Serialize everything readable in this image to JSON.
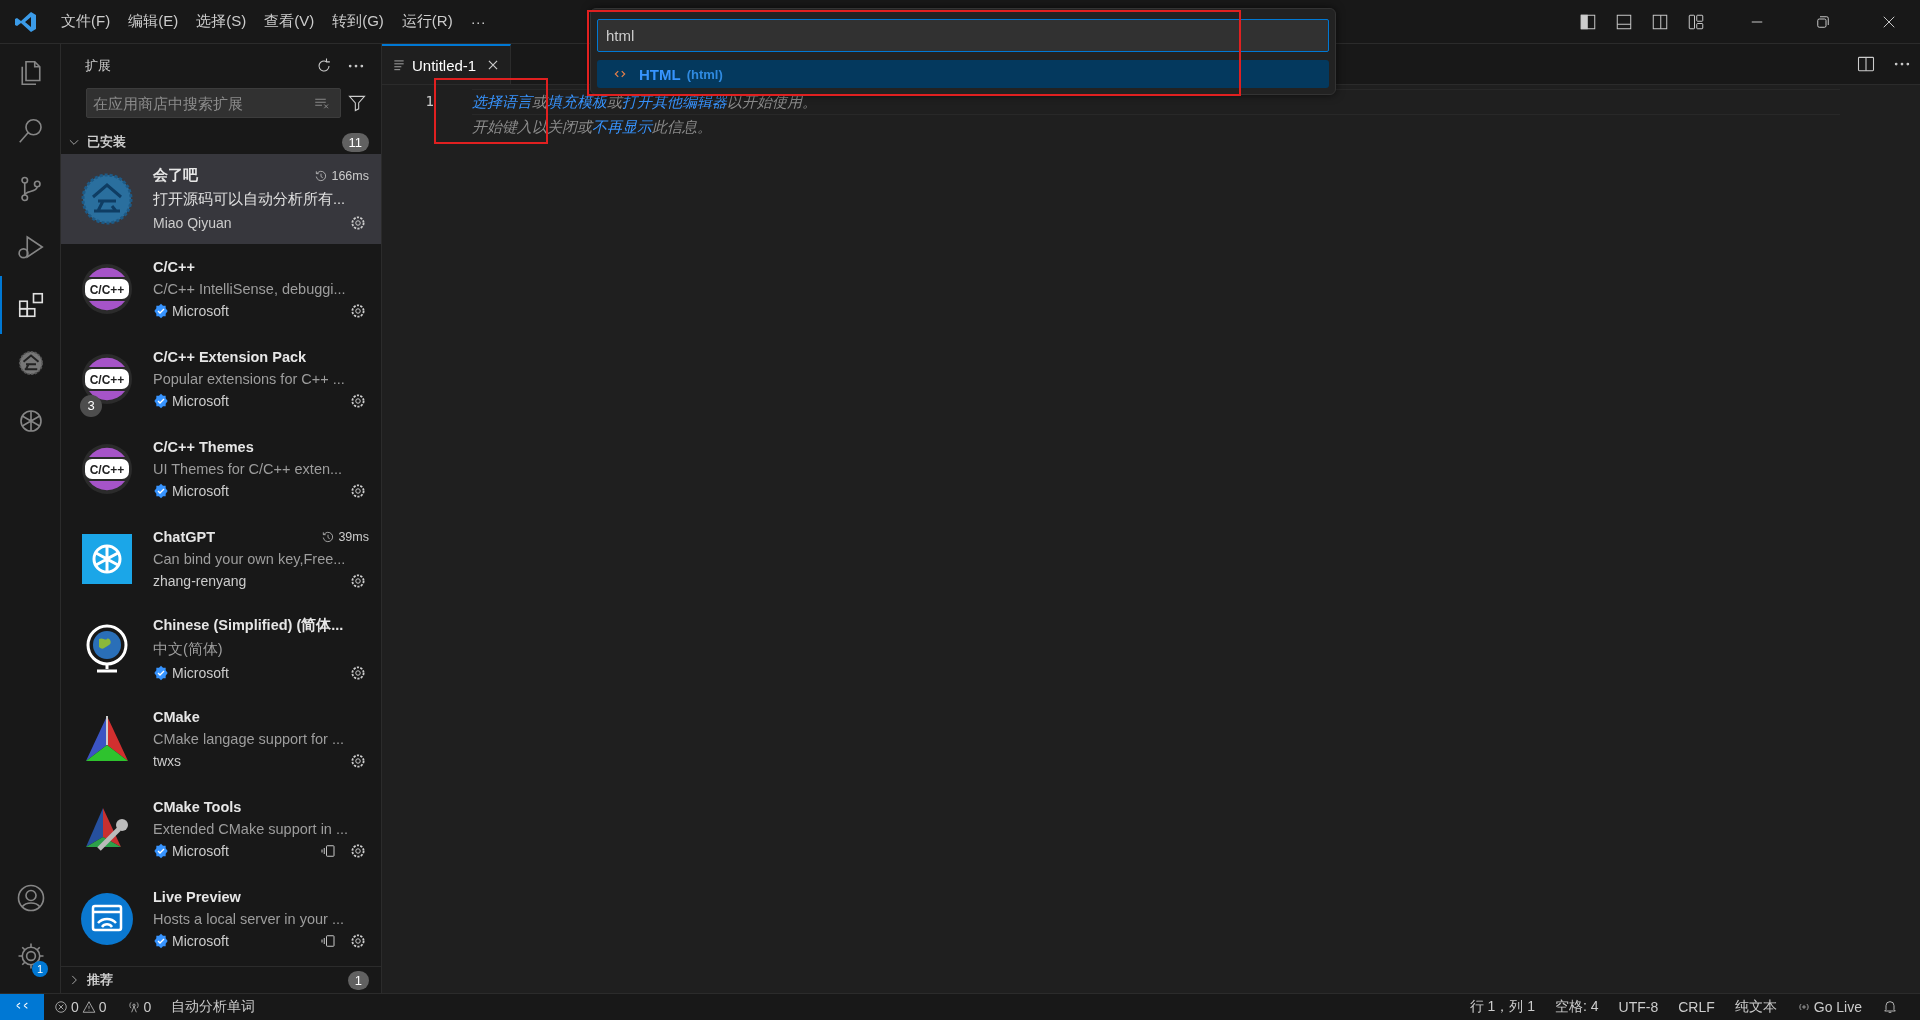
{
  "title_bar": {
    "menus": [
      "文件(F)",
      "编辑(E)",
      "选择(S)",
      "查看(V)",
      "转到(G)",
      "运行(R)"
    ],
    "more": "···"
  },
  "command_palette": {
    "value": "html",
    "results": [
      {
        "label": "HTML",
        "detail": "(html)",
        "selected": true
      }
    ]
  },
  "activity_bar": {
    "items": [
      {
        "selected": false
      },
      {
        "selected": false
      },
      {
        "selected": false
      },
      {
        "selected": false
      },
      {
        "selected": true
      },
      {
        "selected": false
      },
      {
        "selected": false
      }
    ],
    "settings_badge": "1"
  },
  "sidebar": {
    "title": "扩展",
    "search": {
      "placeholder": "在应用商店中搜索扩展"
    },
    "installed": {
      "label": "已安装",
      "count": "11",
      "expanded": true,
      "items": [
        {
          "name": "会了吧",
          "description": "打开源码可以自动分析所有...",
          "publisher": "Miao Qiyuan",
          "verified": false,
          "time": "166ms",
          "selected": true,
          "workspace": false
        },
        {
          "name": "C/C++",
          "description": "C/C++ IntelliSense, debuggi...",
          "publisher": "Microsoft",
          "verified": true,
          "logo_text": "C/C++",
          "selected": false,
          "workspace": false
        },
        {
          "name": "C/C++ Extension Pack",
          "description": "Popular extensions for C++ ...",
          "publisher": "Microsoft",
          "verified": true,
          "logo_text": "C/C++",
          "badge": "3",
          "selected": false,
          "workspace": false
        },
        {
          "name": "C/C++ Themes",
          "description": "UI Themes for C/C++ exten...",
          "publisher": "Microsoft",
          "verified": true,
          "logo_text": "C/C++",
          "selected": false,
          "workspace": false
        },
        {
          "name": "ChatGPT",
          "description": "Can bind your own key,Free...",
          "publisher": "zhang-renyang",
          "verified": false,
          "time": "39ms",
          "selected": false,
          "workspace": false
        },
        {
          "name": "Chinese (Simplified) (简体...",
          "description": "中文(简体)",
          "publisher": "Microsoft",
          "verified": true,
          "selected": false,
          "workspace": false
        },
        {
          "name": "CMake",
          "description": "CMake langage support for ...",
          "publisher": "twxs",
          "verified": false,
          "selected": false,
          "workspace": false
        },
        {
          "name": "CMake Tools",
          "description": "Extended CMake support in ...",
          "publisher": "Microsoft",
          "verified": true,
          "selected": false,
          "workspace": true
        },
        {
          "name": "Live Preview",
          "description": "Hosts a local server in your ...",
          "publisher": "Microsoft",
          "verified": true,
          "selected": false,
          "workspace": true
        }
      ]
    },
    "recommended": {
      "label": "推荐",
      "count": "1",
      "expanded": false
    }
  },
  "editor": {
    "tabs": [
      {
        "title": "Untitled-1",
        "selected": true
      }
    ],
    "line_number": "1",
    "hint_lines": [
      [
        {
          "text": "选择语言",
          "link": true
        },
        {
          "text": "或",
          "link": false
        },
        {
          "text": "填充模板",
          "link": true
        },
        {
          "text": "或",
          "link": false
        },
        {
          "text": "打开其他编辑器",
          "link": true
        },
        {
          "text": "以开始使用。",
          "link": false
        }
      ],
      [
        {
          "text": "开始键入以关闭或",
          "link": false
        },
        {
          "text": "不再显示",
          "link": true
        },
        {
          "text": "此信息。",
          "link": false
        }
      ]
    ]
  },
  "annotations": [
    {
      "kind": "box"
    },
    {
      "kind": "box"
    }
  ],
  "status_bar": {
    "errors": "0",
    "warnings": "0",
    "ports": "0",
    "left_text": "自动分析单词",
    "right": [
      "行 1，列 1",
      "空格: 4",
      "UTF-8",
      "CRLF",
      "纯文本"
    ],
    "go_live": "Go Live"
  }
}
